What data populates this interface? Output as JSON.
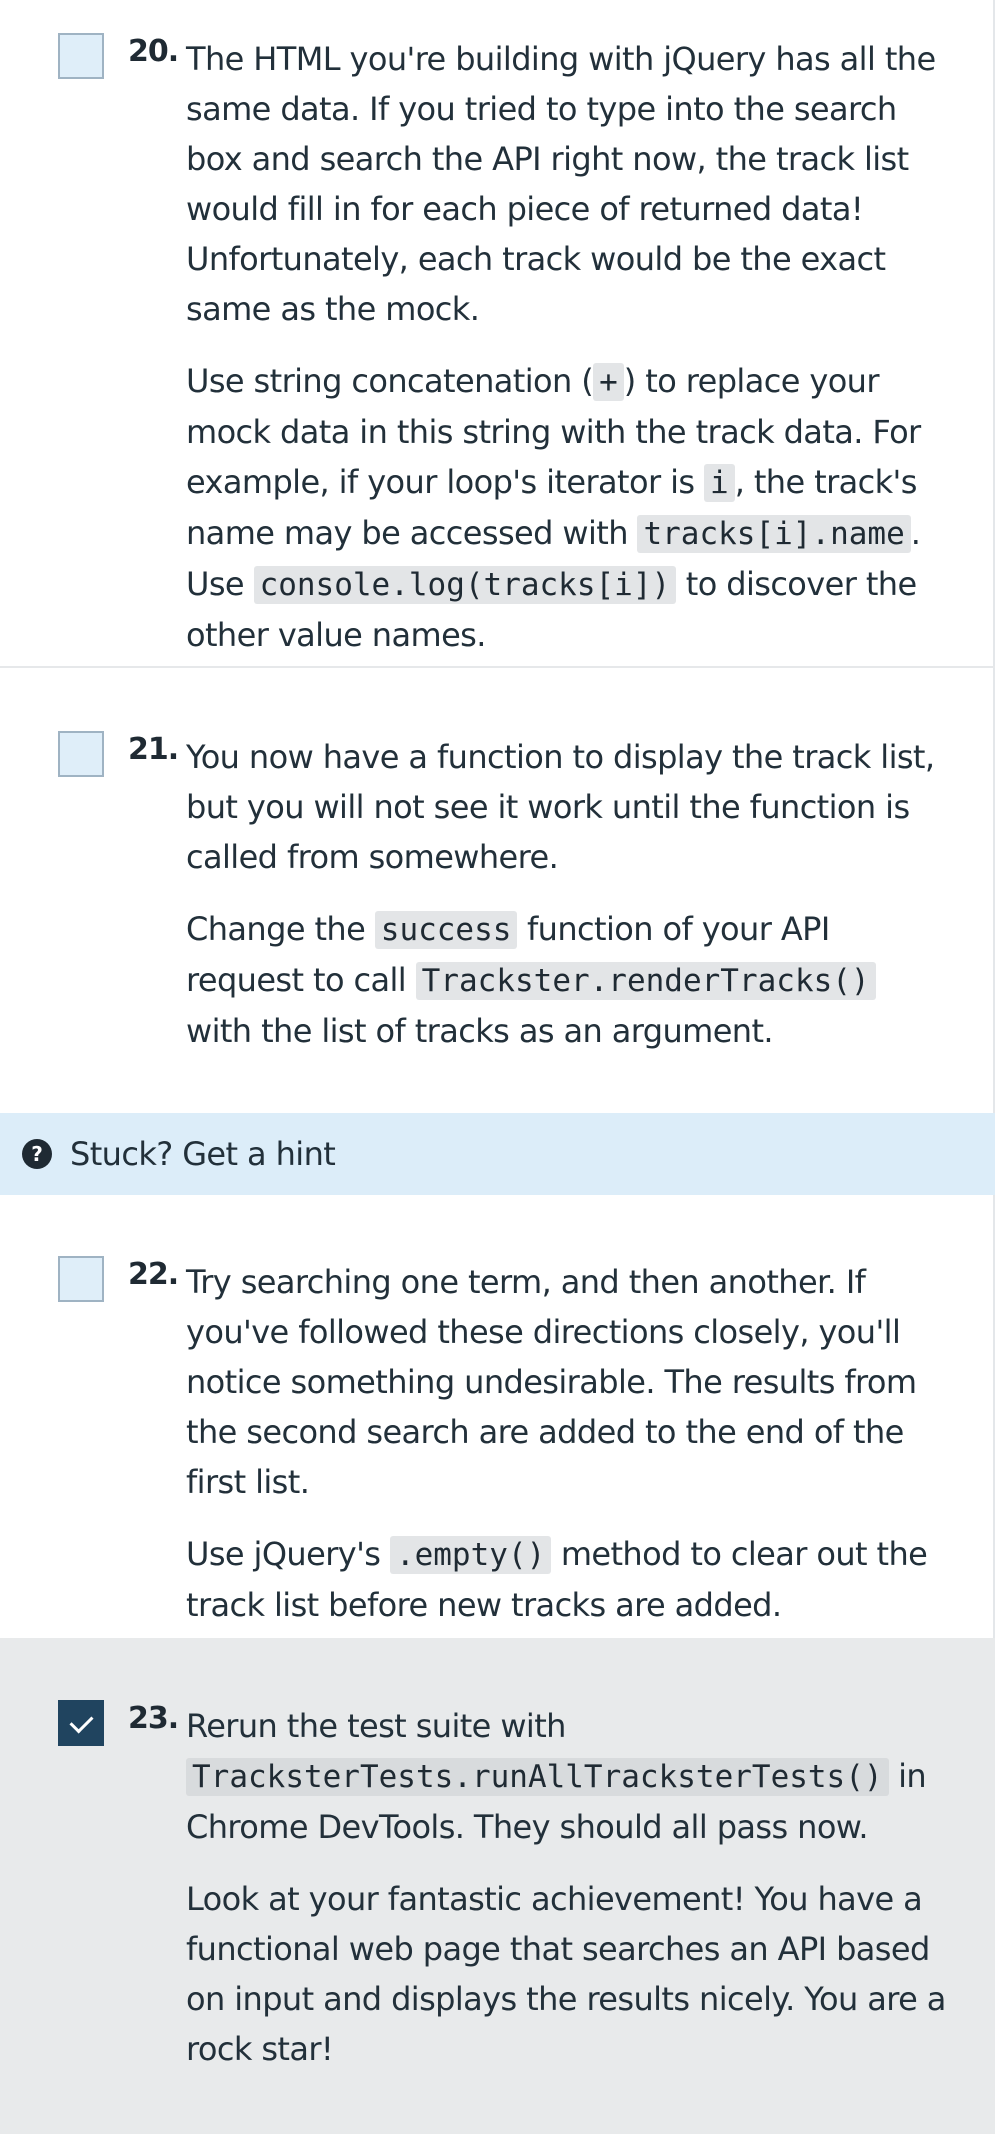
{
  "tasks": {
    "t20": {
      "number": "20.",
      "checked": false,
      "p1": "The HTML you're building with jQuery has all the same data. If you tried to type into the search box and search the API right now, the track list would fill in for each piece of returned data! Unfortunately, each track would be the exact same as the mock.",
      "p2_a": "Use string concatenation (",
      "p2_code1": "+",
      "p2_b": ") to replace your mock data in this string with the track data. For example, if your loop's iterator is ",
      "p2_code2": "i",
      "p2_c": ", the track's name may be accessed with ",
      "p2_code3": "tracks[i].name",
      "p2_d": ". Use ",
      "p2_code4": "console.log(tracks[i])",
      "p2_e": " to discover the other value names."
    },
    "t21": {
      "number": "21.",
      "checked": false,
      "p1": "You now have a function to display the track list, but you will not see it work until the function is called from somewhere.",
      "p2_a": "Change the ",
      "p2_code1": "success",
      "p2_b": " function of your API request to call ",
      "p2_code2": "Trackster.renderTracks()",
      "p2_c": " with the list of tracks as an argument."
    },
    "t22": {
      "number": "22.",
      "checked": false,
      "p1": "Try searching one term, and then another. If you've followed these directions closely, you'll notice something undesirable. The results from the second search are added to the end of the first list.",
      "p2_a": "Use jQuery's ",
      "p2_code1": ".empty()",
      "p2_b": " method to clear out the track list before new tracks are added."
    },
    "t23": {
      "number": "23.",
      "checked": true,
      "p1_a": "Rerun the test suite with ",
      "p1_code1": "TracksterTests.runAllTracksterTests()",
      "p1_b": " in Chrome DevTools. They should all pass now.",
      "p2": "Look at your fantastic achievement! You have a functional web page that searches an API based on input and displays the results nicely. You are a rock star!"
    }
  },
  "hint": {
    "icon": "question-circle-icon",
    "label": "Stuck? Get a hint"
  },
  "colors": {
    "checkbox_unchecked": "#dfeef9",
    "checkbox_checked": "#20445f",
    "hint_background": "#dcedf9",
    "completed_background": "#e8eaeb"
  }
}
